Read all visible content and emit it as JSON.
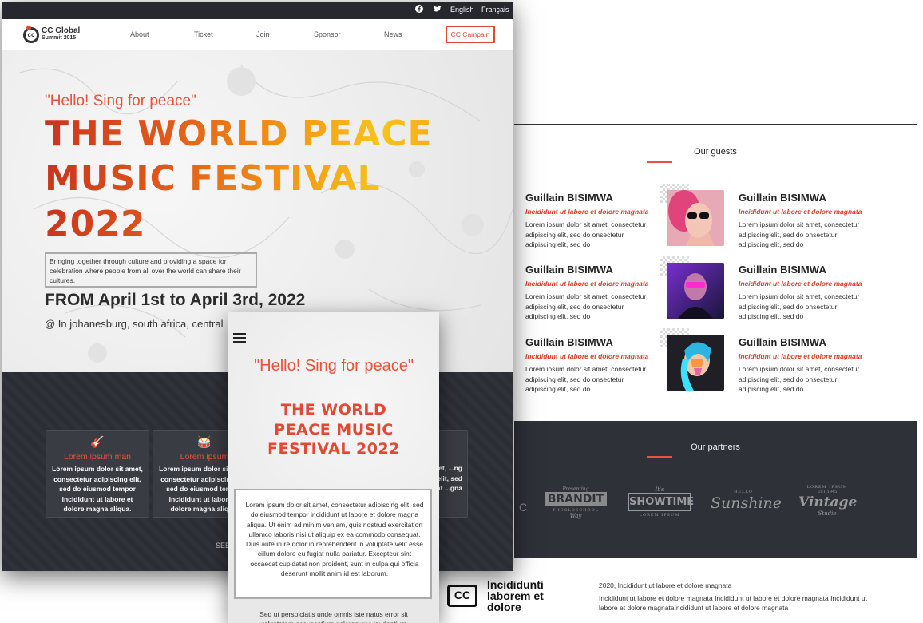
{
  "desktop": {
    "topbar": {
      "lang_en": "English",
      "lang_fr": "Français"
    },
    "logo": {
      "line1": "CC Global",
      "line2": "Summit 2015",
      "mark": "cc"
    },
    "nav": [
      "About",
      "Ticket",
      "Join",
      "Sponsor",
      "News"
    ],
    "cta": "CC Campain",
    "hero": {
      "quote": "\"Hello! Sing for peace\"",
      "title_lines": [
        "THE WORLD PEACE",
        "MUSIC FESTIVAL",
        "2022"
      ],
      "description": "Bringing together through culture and providing a space for celebration where people from all over the world can share their cultures.",
      "date": "FROM April 1st to April 3rd, 2022",
      "location": "@ In johanesburg, south africa, central"
    },
    "features": [
      {
        "icon": "guitar-icon",
        "glyph": "🎸",
        "title": "Lorem ipsum man",
        "text": "Lorem ipsum dolor sit amet, consectetur adipiscing elit, sed do eiusmod tempor incididunt ut labore et dolore magna aliqua."
      },
      {
        "icon": "drum-icon",
        "glyph": "🥁",
        "title": "Lorem ipsum",
        "text": "Lorem ipsum dolor sit amet, consectetur adipiscing elit, sed do eiusmod tempor incididunt ut labore et dolore magna aliqua."
      },
      {
        "icon": "music-icon",
        "glyph": "♪",
        "title": "",
        "text": "...r sit amet, ...ng elit, sed ...incididunt ...gna"
      }
    ],
    "see_more": "SEE T"
  },
  "mobile": {
    "quote": "\"Hello! Sing for peace\"",
    "title_lines": [
      "THE WORLD",
      "PEACE MUSIC",
      "FESTIVAL 2022"
    ],
    "box_text": "Lorem ipsum dolor sit amet, consectetur adipiscing elit, sed do eiusmod tempor incididunt ut labore et dolore magna aliqua. Ut enim ad minim veniam, quis nostrud exercitation ullamco laboris nisi ut aliquip ex ea commodo consequat. Duis aute irure dolor in reprehenderit in voluptate velit esse cillum dolore eu fugiat nulla pariatur. Excepteur sint occaecat cupidatat non proident, sunt in culpa qui officia deserunt mollit anim id est laborum.",
    "text2": "Sed ut perspiciatis unde omnis iste natus error sit voluptatem accusantium doloremque laudantium"
  },
  "guests": {
    "title": "Our guests",
    "items": [
      {
        "name": "Guillain BISIMWA",
        "sub": "Incididunt ut labore et dolore magnata",
        "text": "Lorem ipsum dolor sit amet, consectetur adipiscing elit, sed do onsectetur adipiscing elit, sed do"
      },
      {
        "name": "Guillain BISIMWA",
        "sub": "Incididunt ut labore et dolore magnata",
        "text": "Lorem ipsum dolor sit amet, consectetur adipiscing elit, sed do onsectetur adipiscing elit, sed do"
      },
      {
        "name": "Guillain BISIMWA",
        "sub": "Incididunt ut labore et dolore magnata",
        "text": "Lorem ipsum dolor sit amet, consectetur adipiscing elit, sed do onsectetur adipiscing elit, sed do"
      },
      {
        "name": "Guillain BISIMWA",
        "sub": "Incididunt ut labore et dolore magnata",
        "text": "Lorem ipsum dolor sit amet, consectetur adipiscing elit, sed do onsectetur adipiscing elit, sed do"
      },
      {
        "name": "Guillain BISIMWA",
        "sub": "Incididunt ut labore et dolore magnata",
        "text": "Lorem ipsum dolor sit amet, consectetur adipiscing elit, sed do onsectetur adipiscing elit, sed do"
      },
      {
        "name": "Guillain BISIMWA",
        "sub": "Incididunt ut labore et dolore magnata",
        "text": "Lorem ipsum dolor sit amet, consectetur adipiscing elit, sed do onsectetur adipiscing elit, sed do"
      }
    ]
  },
  "partners": {
    "title": "Our partners",
    "logos": [
      {
        "name": "BRANDIT",
        "top": "Presenting",
        "bottom": "THEOLOSCHOOL",
        "tag": "Way"
      },
      {
        "name": "SHOWTIME",
        "top": "It's",
        "bottom": "LOREM IPSUM"
      },
      {
        "name": "Sunshine",
        "top": "HELLO"
      },
      {
        "name": "Vintage",
        "top": "LOREM IPSUM",
        "tag": "EST 1945",
        "bottom": "Studio"
      }
    ]
  },
  "footer": {
    "brand_mark": "CC",
    "brand": "Incididunti laborem et dolore",
    "line1": "2020, Incididunt ut labore et dolore magnata",
    "line2": "Incididunt ut labore et dolore magnata Incididunt ut labore et dolore magnata Incididunt ut labore et dolore magnataIncididunt ut labore et dolore magnata"
  },
  "colors": {
    "accent": "#e9523a",
    "dark": "#2c2e35",
    "gold": "#f8c21a"
  }
}
